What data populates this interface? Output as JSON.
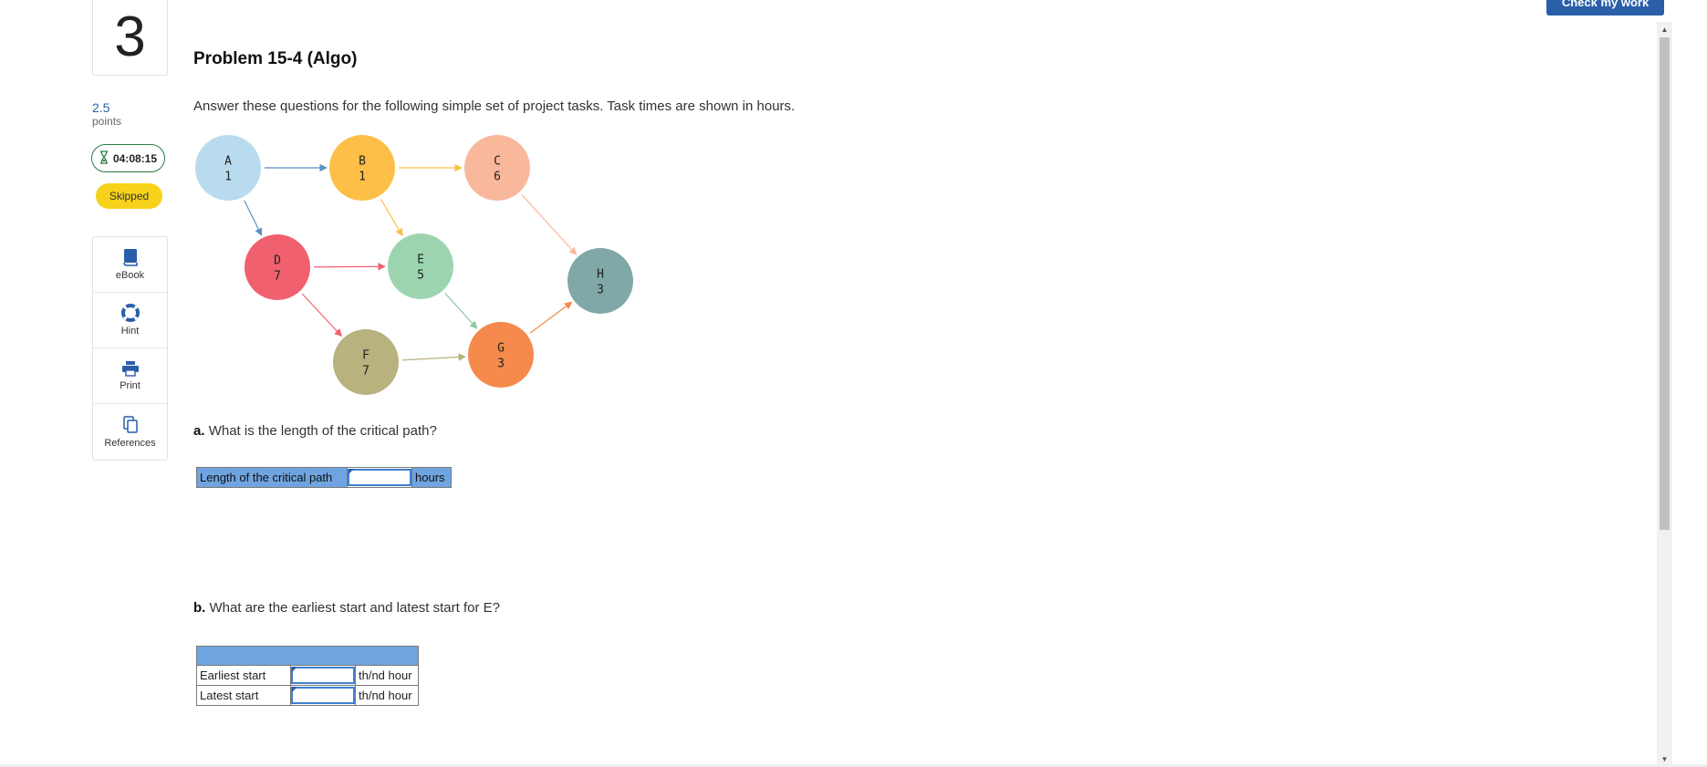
{
  "question": {
    "number": "3",
    "points_value": "2.5",
    "points_label": "points",
    "timer": "04:08:15",
    "status": "Skipped"
  },
  "tools": [
    {
      "label": "eBook",
      "icon": "book-icon"
    },
    {
      "label": "Hint",
      "icon": "lifebuoy-icon"
    },
    {
      "label": "Print",
      "icon": "printer-icon"
    },
    {
      "label": "References",
      "icon": "copy-icon"
    }
  ],
  "header": {
    "check_button": "Check my work"
  },
  "problem": {
    "title": "Problem 15-4 (Algo)",
    "intro": "Answer these questions for the following simple set of project tasks. Task times are shown in hours."
  },
  "network": {
    "nodes": [
      {
        "id": "A",
        "time": "1",
        "color": "#b9dbef"
      },
      {
        "id": "B",
        "time": "1",
        "color": "#fdbf47"
      },
      {
        "id": "C",
        "time": "6",
        "color": "#f9b89b"
      },
      {
        "id": "D",
        "time": "7",
        "color": "#f0606e"
      },
      {
        "id": "E",
        "time": "5",
        "color": "#9dd4b0"
      },
      {
        "id": "F",
        "time": "7",
        "color": "#b7b27e"
      },
      {
        "id": "G",
        "time": "3",
        "color": "#f58a4c"
      },
      {
        "id": "H",
        "time": "3",
        "color": "#7fa8a6"
      }
    ],
    "edges": [
      {
        "from": "A",
        "to": "B",
        "color": "#5a8fc2"
      },
      {
        "from": "A",
        "to": "D",
        "color": "#5a8fc2"
      },
      {
        "from": "B",
        "to": "C",
        "color": "#fdbf47"
      },
      {
        "from": "B",
        "to": "E",
        "color": "#fdbf47"
      },
      {
        "from": "C",
        "to": "H",
        "color": "#f9b89b"
      },
      {
        "from": "D",
        "to": "E",
        "color": "#f0606e"
      },
      {
        "from": "D",
        "to": "F",
        "color": "#f0606e"
      },
      {
        "from": "E",
        "to": "G",
        "color": "#8cc7a0"
      },
      {
        "from": "F",
        "to": "G",
        "color": "#b7b27e"
      },
      {
        "from": "G",
        "to": "H",
        "color": "#f58a4c"
      }
    ]
  },
  "part_a": {
    "prefix": "a.",
    "question": "What is the length of the critical path?",
    "row_label": "Length of the critical path",
    "input_value": "",
    "unit": "hours"
  },
  "part_b": {
    "prefix": "b.",
    "question": "What are the earliest start and latest start for E?",
    "rows": [
      {
        "label": "Earliest start",
        "value": "",
        "unit": "th/nd hour"
      },
      {
        "label": "Latest start",
        "value": "",
        "unit": "th/nd hour"
      }
    ]
  }
}
